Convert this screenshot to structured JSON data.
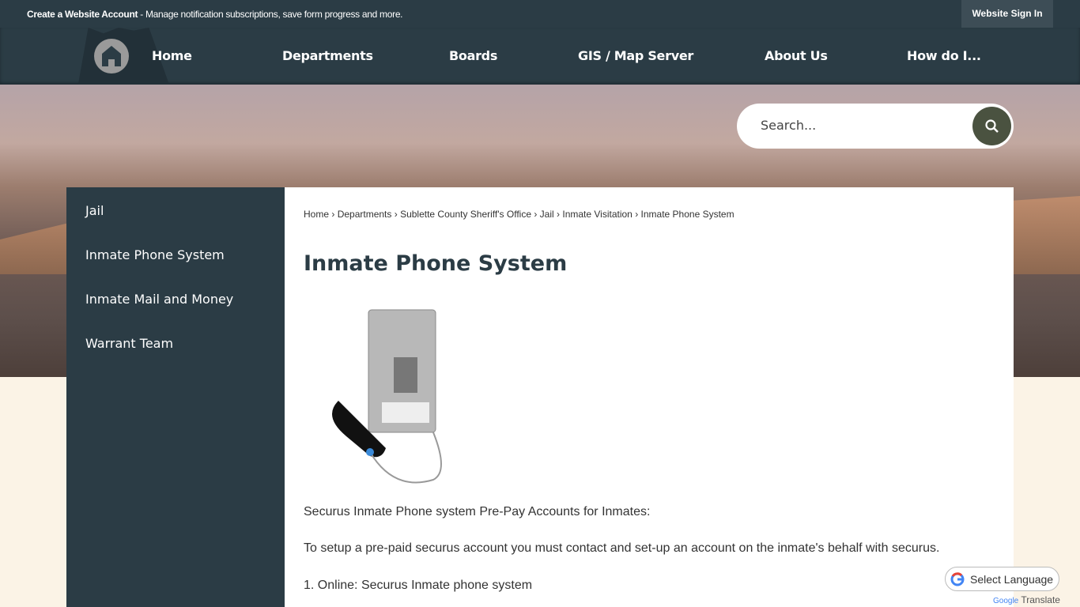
{
  "topbar": {
    "account_link": "Create a Website Account",
    "account_msg": " - Manage notification subscriptions, save form progress and more.",
    "sign_in": "Website Sign In"
  },
  "nav": {
    "items": [
      "Home",
      "Departments",
      "Boards",
      "GIS / Map Server",
      "About Us",
      "How do I..."
    ]
  },
  "search": {
    "placeholder": "Search..."
  },
  "sidebar": {
    "items": [
      "Jail",
      "Inmate Phone System",
      "Inmate Mail and Money",
      "Warrant Team"
    ]
  },
  "breadcrumb": [
    "Home",
    "Departments",
    "Sublette County Sheriff's Office",
    "Jail",
    "Inmate Visitation",
    "Inmate Phone System"
  ],
  "page": {
    "title": "Inmate Phone System",
    "p1": "Securus Inmate Phone system Pre-Pay Accounts for Inmates:",
    "p2": "To setup a pre-paid securus account you must contact and set-up an account on the inmate's behalf with securus.",
    "p3_prefix": "1. Online: ",
    "p3_link": "Securus",
    "p3_suffix": " Inmate phone system"
  },
  "translate": {
    "label": "Select Language",
    "brand": "Google",
    "suffix": "Translate"
  }
}
